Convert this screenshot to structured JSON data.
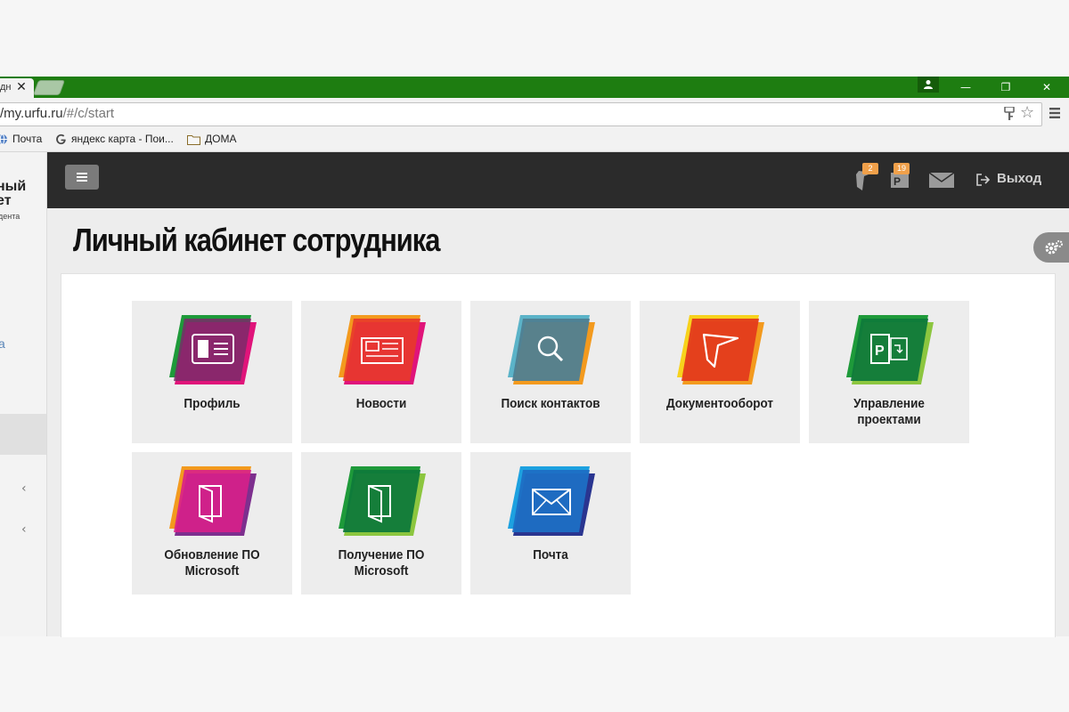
{
  "browser": {
    "tab_title": "дн",
    "tab_close": "✕",
    "window_controls": {
      "minimize": "—",
      "restore": "❐",
      "close": "✕"
    },
    "url_host": "/my.urfu.ru",
    "url_path": "/#/c/start",
    "bookmarks": [
      {
        "label": "Почта",
        "icon": "globe-icon"
      },
      {
        "label": "яндекс карта - Пои...",
        "icon": "google-icon"
      },
      {
        "label": "ДОМА",
        "icon": "folder-icon"
      }
    ]
  },
  "sidebar": {
    "logo_line1": "ный",
    "logo_line2": "ет",
    "logo_line3": "дента",
    "link_a": "а",
    "chevron1": "‹",
    "chevron2": "‹"
  },
  "topnav": {
    "badges": {
      "documents": "2",
      "projects": "19"
    },
    "logout_label": "Выход"
  },
  "page": {
    "title": "Личный кабинет сотрудника"
  },
  "tiles": [
    {
      "label_lines": [
        "Профиль"
      ],
      "icon": "profile-card-icon",
      "colors": [
        "#1e9a3a",
        "#e0147a"
      ]
    },
    {
      "label_lines": [
        "Новости"
      ],
      "icon": "newspaper-icon",
      "colors": [
        "#f39a1e",
        "#e0147a"
      ]
    },
    {
      "label_lines": [
        "Поиск контактов"
      ],
      "icon": "magnifier-icon",
      "colors": [
        "#5bb3c8",
        "#f39a1e"
      ]
    },
    {
      "label_lines": [
        "Документооборот"
      ],
      "icon": "boomerang-icon",
      "colors": [
        "#f7d21c",
        "#e33b1c"
      ]
    },
    {
      "label_lines": [
        "Управление",
        "проектами"
      ],
      "icon": "ms-project-icon",
      "colors": [
        "#8cc63f",
        "#0f7a3a"
      ]
    },
    {
      "label_lines": [
        "Обновление ПО",
        "Microsoft"
      ],
      "icon": "office-update-icon",
      "colors": [
        "#f39a1e",
        "#7d2f8e"
      ]
    },
    {
      "label_lines": [
        "Получение ПО",
        "Microsoft"
      ],
      "icon": "office-get-icon",
      "colors": [
        "#8cc63f",
        "#0f7a3a"
      ]
    },
    {
      "label_lines": [
        "Почта"
      ],
      "icon": "mail-envelope-icon",
      "colors": [
        "#1da1e0",
        "#2a3590"
      ]
    }
  ]
}
